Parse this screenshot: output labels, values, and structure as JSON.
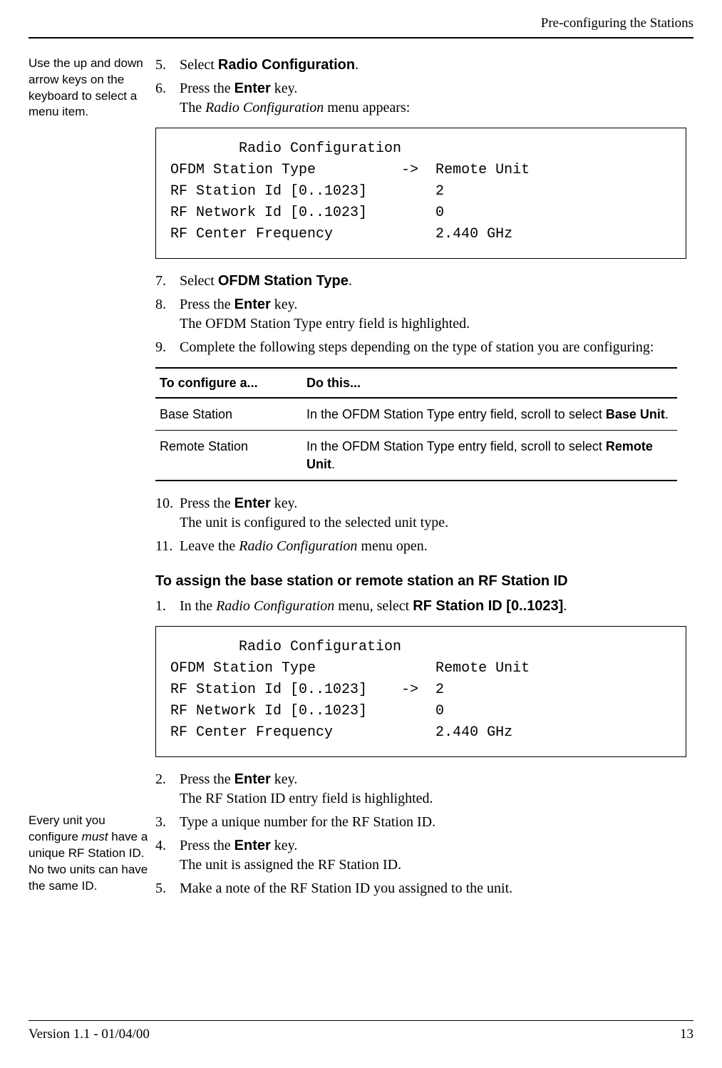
{
  "header": {
    "section_title": "Pre-configuring the Stations"
  },
  "sidenotes": {
    "a": "Use the up and down arrow keys on the keyboard to select a menu item.",
    "b_prefix": "Every unit you configure ",
    "b_em": "must",
    "b_suffix": " have a unique RF Station ID. No two units can have the same ID."
  },
  "stepsA": {
    "s5": {
      "num": "5.",
      "pre": "Select ",
      "bold": "Radio Configuration",
      "post": "."
    },
    "s6": {
      "num": "6.",
      "pre": "Press the ",
      "bold": "Enter",
      "post": " key.",
      "sub_pre": "The ",
      "sub_ital": "Radio Configuration",
      "sub_post": " menu appears:"
    },
    "s7": {
      "num": "7.",
      "pre": "Select ",
      "bold": "OFDM Station Type",
      "post": "."
    },
    "s8": {
      "num": "8.",
      "pre": "Press the ",
      "bold": "Enter",
      "post": " key.",
      "sub": "The OFDM Station Type entry field is highlighted."
    },
    "s9": {
      "num": "9.",
      "text": "Complete the following steps depending on the type of station you are configuring:"
    },
    "s10": {
      "num": "10.",
      "pre": "Press the ",
      "bold": "Enter",
      "post": " key.",
      "sub": "The unit is configured to the selected unit type."
    },
    "s11": {
      "num": "11.",
      "pre": "Leave the ",
      "ital": "Radio Configuration",
      "post": " menu open."
    }
  },
  "menu1": {
    "title": "Radio Configuration",
    "rows": [
      {
        "label": "OFDM Station Type",
        "arrow": "->",
        "value": "Remote Unit"
      },
      {
        "label": "RF Station Id [0..1023]",
        "arrow": "  ",
        "value": "2"
      },
      {
        "label": "RF Network Id [0..1023]",
        "arrow": "  ",
        "value": "0"
      },
      {
        "label": "RF Center Frequency",
        "arrow": "  ",
        "value": "2.440 GHz"
      }
    ]
  },
  "table": {
    "th1": "To configure a...",
    "th2": "Do this...",
    "r1c1": "Base Station",
    "r1c2_pre": "In the OFDM Station Type entry field, scroll to select ",
    "r1c2_bold": "Base Unit",
    "r1c2_post": ".",
    "r2c1": "Remote Station",
    "r2c2_pre": "In the OFDM Station Type entry field, scroll to select ",
    "r2c2_bold": "Remote Unit",
    "r2c2_post": "."
  },
  "subhead": "To assign the base station or remote station an RF Station ID",
  "stepsB": {
    "s1": {
      "num": "1.",
      "pre": "In the ",
      "ital": "Radio Configuration",
      "mid": " menu, select ",
      "bold": "RF Station ID [0..1023]",
      "post": "."
    },
    "s2": {
      "num": "2.",
      "pre": "Press the ",
      "bold": "Enter",
      "post": " key.",
      "sub": "The RF Station ID entry field is highlighted."
    },
    "s3": {
      "num": "3.",
      "text": "Type a unique number for the RF Station ID."
    },
    "s4": {
      "num": "4.",
      "pre": "Press the ",
      "bold": "Enter",
      "post": " key.",
      "sub": "The unit is assigned the RF Station ID."
    },
    "s5": {
      "num": "5.",
      "text": "Make a note of the RF Station ID you assigned to the unit."
    }
  },
  "menu2": {
    "title": "Radio Configuration",
    "rows": [
      {
        "label": "OFDM Station Type",
        "arrow": "  ",
        "value": "Remote Unit"
      },
      {
        "label": "RF Station Id [0..1023]",
        "arrow": "->",
        "value": "2"
      },
      {
        "label": "RF Network Id [0..1023]",
        "arrow": "  ",
        "value": "0"
      },
      {
        "label": "RF Center Frequency",
        "arrow": "  ",
        "value": "2.440 GHz"
      }
    ]
  },
  "footer": {
    "left": "Version 1.1 - 01/04/00",
    "right": "13"
  }
}
